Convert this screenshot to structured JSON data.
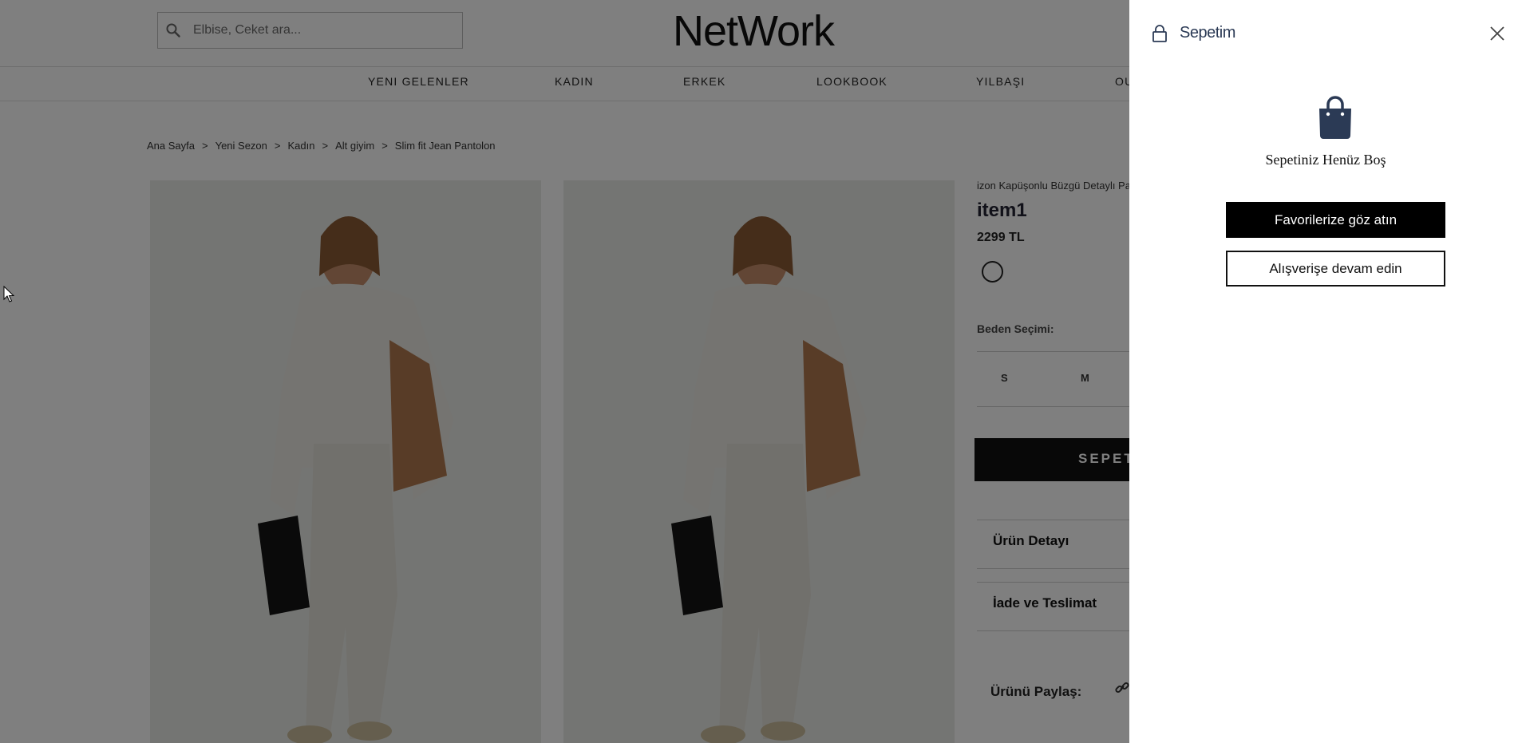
{
  "header": {
    "logo": "NetWork",
    "search_placeholder": "Elbise, Ceket ara..."
  },
  "nav": [
    "YENI GELENLER",
    "KADIN",
    "ERKEK",
    "LOOKBOOK",
    "YILBAŞI",
    "OU"
  ],
  "breadcrumb": [
    "Ana Sayfa",
    "Yeni Sezon",
    "Kadın",
    "Alt giyim",
    "Slim fit Jean Pantolon"
  ],
  "breadcrumb_separator": ">",
  "product": {
    "subtitle": "izon Kapüşonlu Büzgü Detaylı Pa",
    "name": "item1",
    "price": "2299 TL",
    "size_label": "Beden Seçimi:",
    "sizes": [
      "S",
      "M"
    ],
    "add_to_cart": "SEPETE",
    "accordion": [
      "Ürün Detayı",
      "İade ve Teslimat"
    ],
    "share_label": "Ürünü Paylaş:"
  },
  "cart": {
    "title": "Sepetim",
    "empty_text": "Sepetiniz Henüz Boş",
    "favorites_button": "Favorilerize göz atın",
    "continue_button": "Alışverişe devam edin"
  },
  "colors": {
    "overlay": "rgba(0,0,0,0.5)",
    "cart_title": "#2b3a55",
    "bag_icon": "#2b3a55",
    "primary_button": "#000000"
  }
}
